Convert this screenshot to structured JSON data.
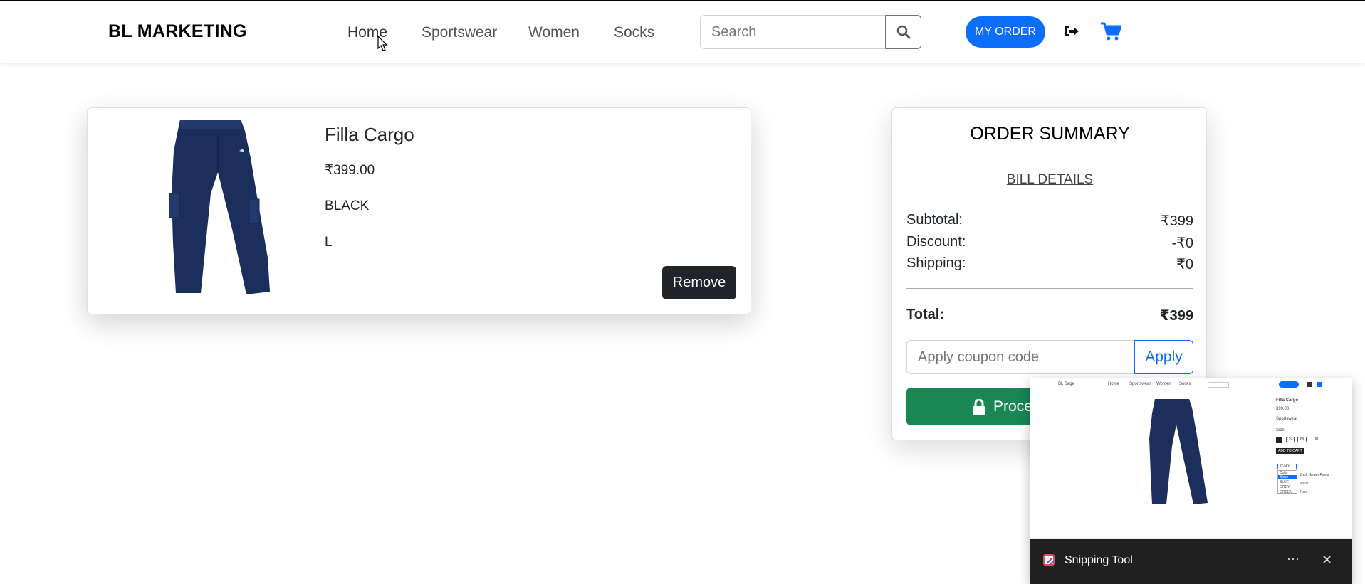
{
  "navbar": {
    "brand": "BL MARKETING",
    "links": [
      "Home",
      "Sportswear",
      "Women",
      "Socks"
    ],
    "search_placeholder": "Search",
    "my_order_label": "MY ORDER"
  },
  "cart_item": {
    "name": "Filla Cargo",
    "price": "₹399.00",
    "color": "BLACK",
    "size": "L",
    "remove_label": "Remove"
  },
  "summary": {
    "title": "ORDER SUMMARY",
    "bill_details": "BILL DETAILS",
    "subtotal_label": "Subtotal:",
    "subtotal_value": "₹399",
    "discount_label": "Discount:",
    "discount_value": "-₹0",
    "shipping_label": "Shipping:",
    "shipping_value": "₹0",
    "total_label": "Total:",
    "total_value": "₹399",
    "coupon_placeholder": "Apply coupon code",
    "apply_label": "Apply",
    "proceed_label": "Proce"
  },
  "snipping_tool": {
    "app_name": "Snipping Tool",
    "more": "···",
    "close": "✕",
    "preview": {
      "brand": "BL Sage",
      "links": [
        "Home",
        "Sportswear",
        "Women",
        "Socks"
      ],
      "product_name": "Filla Cargo",
      "price": "399.00",
      "category": "Sportswear",
      "size_label": "Size",
      "sizes": [
        "S",
        "M",
        "XL"
      ],
      "add_to_cart": "ADD TO CART",
      "color_select": "Color",
      "color_options": [
        "Color",
        "Black",
        "BLUE",
        "GREY",
        "GREEN"
      ],
      "colors_text": [
        "Dark Brown Pants",
        "Navy",
        "Pant"
      ]
    }
  },
  "colors": {
    "primary": "#0d6efd",
    "success": "#198754",
    "dark": "#212529",
    "pants": "#1c2f5c"
  }
}
